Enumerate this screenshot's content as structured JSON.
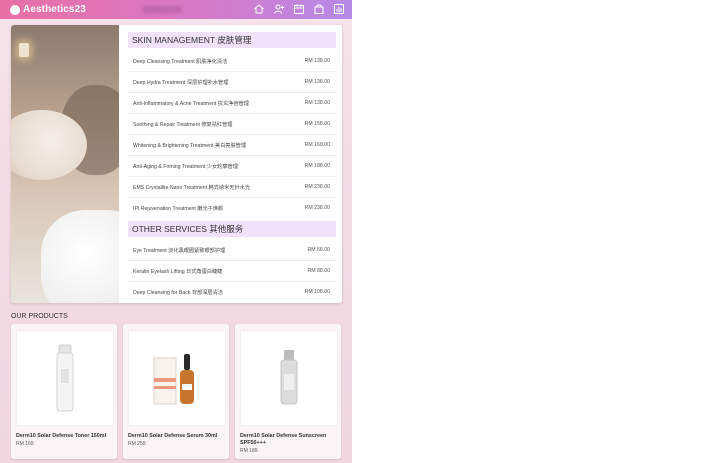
{
  "header": {
    "brand": "Aesthetics23",
    "icons": [
      "home-icon",
      "add-user-icon",
      "calendar-icon",
      "shopping-bag-icon",
      "bar-chart-icon"
    ]
  },
  "skin": {
    "title": "SKIN MANAGEMENT 皮肤管理",
    "items": [
      {
        "name": "Deep Cleansing Treatment 肌肤净化清洁",
        "price": "RM 138.00"
      },
      {
        "name": "Deep Hydra Treatment 深层护理补水管理",
        "price": "RM 138.00"
      },
      {
        "name": "Anti-Inflammatory & Acne Treatment 抗炎净痘管理",
        "price": "RM 138.00"
      },
      {
        "name": "Soothing & Repair Treatment 修复祛红管理",
        "price": "RM 158.00"
      },
      {
        "name": "Whitening & Brightening Treatment 美白亮肤管理",
        "price": "RM 168.00"
      },
      {
        "name": "Anti-Aging & Firming Treatment 少女轮廓管理",
        "price": "RM 188.00"
      },
      {
        "name": "EMS Crystallite Nano Treatment 韩式纳米无针水光",
        "price": "RM 238.00"
      },
      {
        "name": "IPI Rejuvenation Treatment 嫩光子焕颜",
        "price": "RM 238.00"
      }
    ]
  },
  "other": {
    "title": "OTHER SERVICES 其他服务",
    "items": [
      {
        "name": "Eye Treatment 淡化黑眼圈紧致眼部护理",
        "price": "RM 68.00"
      },
      {
        "name": "Keratin Eyelash Lifting 日式角蛋白睫睫",
        "price": "RM 88.00"
      },
      {
        "name": "Deep Cleansing for Back 背部深层清洁",
        "price": "RM 108.00"
      }
    ]
  },
  "products": {
    "title": "OUR PRODUCTS",
    "items": [
      {
        "name": "Derm10 Solar Defense Toner 150ml",
        "price": "RM 169"
      },
      {
        "name": "Derm10 Solar Defense Serum 30ml",
        "price": "RM 259"
      },
      {
        "name": "Derm10 Solar Defense Sunscreen SPF50+++",
        "price": "RM 189"
      }
    ]
  }
}
